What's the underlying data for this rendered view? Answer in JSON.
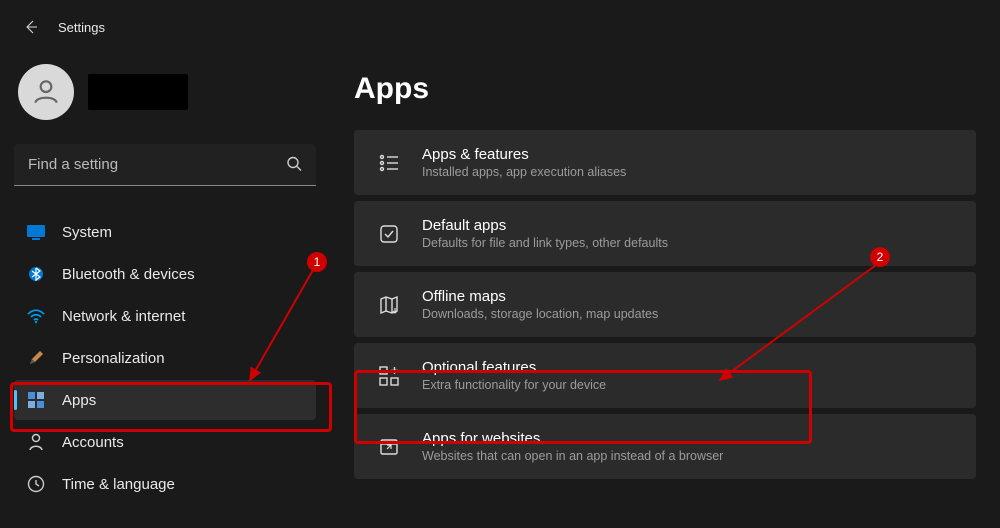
{
  "topbar": {
    "title": "Settings"
  },
  "profile": {
    "name": ""
  },
  "search": {
    "placeholder": "Find a setting"
  },
  "sidebar": {
    "items": [
      {
        "id": "system",
        "label": "System",
        "selected": false
      },
      {
        "id": "bluetooth",
        "label": "Bluetooth & devices",
        "selected": false
      },
      {
        "id": "network",
        "label": "Network & internet",
        "selected": false
      },
      {
        "id": "personalization",
        "label": "Personalization",
        "selected": false
      },
      {
        "id": "apps",
        "label": "Apps",
        "selected": true
      },
      {
        "id": "accounts",
        "label": "Accounts",
        "selected": false
      },
      {
        "id": "time",
        "label": "Time & language",
        "selected": false
      }
    ]
  },
  "main": {
    "title": "Apps",
    "cards": [
      {
        "id": "apps-features",
        "title": "Apps & features",
        "sub": "Installed apps, app execution aliases"
      },
      {
        "id": "default-apps",
        "title": "Default apps",
        "sub": "Defaults for file and link types, other defaults"
      },
      {
        "id": "offline-maps",
        "title": "Offline maps",
        "sub": "Downloads, storage location, map updates"
      },
      {
        "id": "optional-features",
        "title": "Optional features",
        "sub": "Extra functionality for your device"
      },
      {
        "id": "apps-websites",
        "title": "Apps for websites",
        "sub": "Websites that can open in an app instead of a browser"
      }
    ]
  },
  "annotations": {
    "marker1": "1",
    "marker2": "2"
  }
}
